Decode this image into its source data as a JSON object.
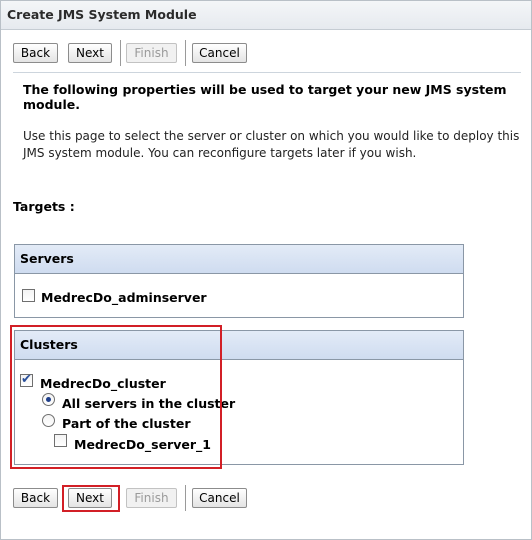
{
  "title": "Create JMS System Module",
  "toolbar": {
    "back": "Back",
    "next": "Next",
    "finish": "Finish",
    "cancel": "Cancel"
  },
  "heading": "The following properties will be used to target your new JMS system module.",
  "description": "Use this page to select the server or cluster on which you would like to deploy this JMS system module. You can reconfigure targets later if you wish.",
  "targets_label": "Targets :",
  "servers_panel": {
    "title": "Servers",
    "items": [
      {
        "label": "MedrecDo_adminserver",
        "checked": false
      }
    ]
  },
  "clusters_panel": {
    "title": "Clusters",
    "cluster": {
      "label": "MedrecDo_cluster",
      "checked": true
    },
    "options": [
      {
        "label": "All servers in the cluster",
        "selected": true
      },
      {
        "label": "Part of the cluster",
        "selected": false
      }
    ],
    "servers": [
      {
        "label": "MedrecDo_server_1",
        "checked": false
      }
    ]
  },
  "colors": {
    "highlight": "#d21f26",
    "panel_header": "#d9e4f4",
    "border": "#8a97a6"
  }
}
